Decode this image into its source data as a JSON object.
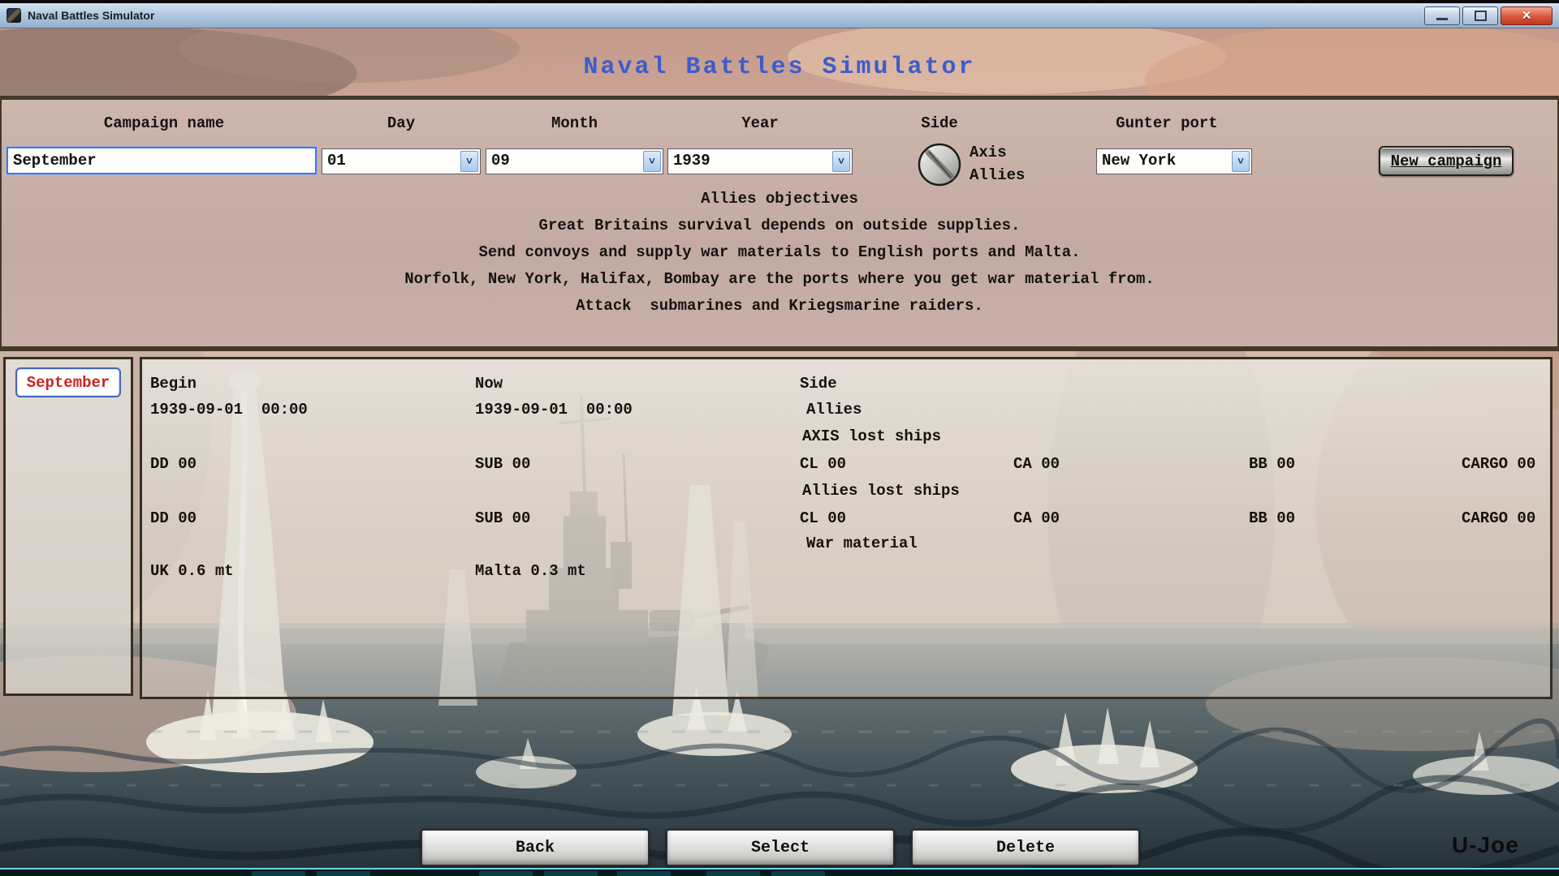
{
  "window": {
    "title": "Naval Battles Simulator",
    "controls": {
      "minimize": "minimize",
      "maximize": "maximize",
      "close": "✕"
    }
  },
  "header": {
    "title": "Naval Battles Simulator"
  },
  "form": {
    "campaign_name": {
      "label": "Campaign name",
      "value": "September"
    },
    "day": {
      "label": "Day",
      "value": "01"
    },
    "month": {
      "label": "Month",
      "value": "09"
    },
    "year": {
      "label": "Year",
      "value": "1939"
    },
    "side": {
      "label": "Side",
      "option_axis": "Axis",
      "option_allies": "Allies"
    },
    "gunter_port": {
      "label": "Gunter port",
      "value": "New York"
    },
    "new_campaign_label": "New campaign",
    "dropdown_glyph": "˅"
  },
  "objectives": {
    "lines": [
      "Allies objectives",
      "Great Britains survival depends on outside supplies.",
      "Send convoys and supply war materials to English ports and Malta.",
      "Norfolk, New York, Halifax, Bombay are the ports where you get war material from.",
      "Attack  submarines and Kriegsmarine raiders."
    ]
  },
  "campaign_list": {
    "selected_item": "September"
  },
  "details": {
    "begin_label": "Begin",
    "begin_value": "1939-09-01  00:00",
    "now_label": "Now",
    "now_value": "1939-09-01  00:00",
    "side_label": "Side",
    "side_value": "Allies",
    "axis_section": "AXIS lost ships",
    "allies_section": "Allies lost ships",
    "war_section": "War material",
    "axis_lost": {
      "dd": "DD 00",
      "sub": "SUB 00",
      "cl": "CL 00",
      "ca": "CA 00",
      "bb": "BB 00",
      "cargo": "CARGO 00"
    },
    "allies_lost": {
      "dd": "DD 00",
      "sub": "SUB 00",
      "cl": "CL 00",
      "ca": "CA 00",
      "bb": "BB 00",
      "cargo": "CARGO 00"
    },
    "war": {
      "uk": "UK 0.6 mt",
      "malta": "Malta 0.3 mt"
    }
  },
  "footer": {
    "back": "Back",
    "select": "Select",
    "delete": "Delete",
    "credit": "U-Joe"
  },
  "colors": {
    "title_blue": "#3d5ccc",
    "selected_red": "#cc2222",
    "focus_blue": "#4f74cc",
    "panel_mauve": "#c3aaa3",
    "taskbar_teal": "#6fd4e2"
  }
}
